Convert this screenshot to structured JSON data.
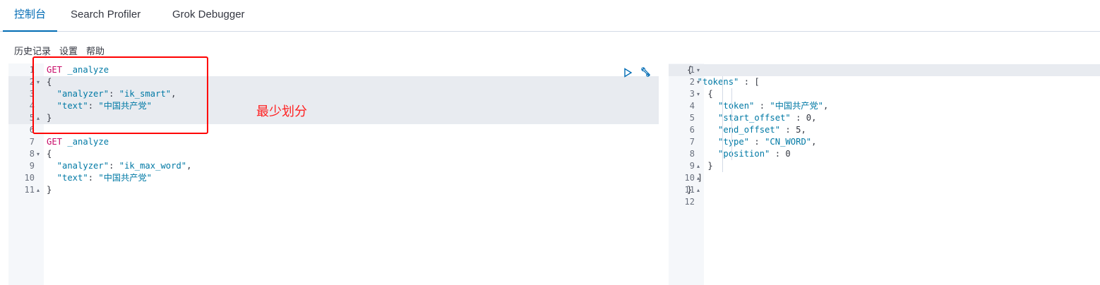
{
  "tabs": [
    {
      "label": "控制台",
      "active": true
    },
    {
      "label": "Search Profiler",
      "active": false
    },
    {
      "label": "Grok Debugger",
      "active": false
    }
  ],
  "toolbar": {
    "history": "历史记录",
    "settings": "设置",
    "help": "帮助"
  },
  "request_editor": {
    "line_numbers": [
      "1",
      "2",
      "3",
      "4",
      "5",
      "6",
      "7",
      "8",
      "9",
      "10",
      "11"
    ],
    "lines": [
      [
        {
          "t": "GET",
          "c": "kw"
        },
        {
          "t": " _analyze",
          "c": "str"
        }
      ],
      [
        {
          "t": "{",
          "c": "plain"
        }
      ],
      [
        {
          "t": "  \"analyzer\"",
          "c": "str"
        },
        {
          "t": ": ",
          "c": "plain"
        },
        {
          "t": "\"ik_smart\"",
          "c": "str"
        },
        {
          "t": ",",
          "c": "plain"
        }
      ],
      [
        {
          "t": "  \"text\"",
          "c": "str"
        },
        {
          "t": ": ",
          "c": "plain"
        },
        {
          "t": "\"中国共产党\"",
          "c": "str"
        }
      ],
      [
        {
          "t": "}",
          "c": "plain"
        }
      ],
      [],
      [
        {
          "t": "GET",
          "c": "kw"
        },
        {
          "t": " _analyze",
          "c": "str"
        }
      ],
      [
        {
          "t": "{",
          "c": "plain"
        }
      ],
      [
        {
          "t": "  \"analyzer\"",
          "c": "str"
        },
        {
          "t": ": ",
          "c": "plain"
        },
        {
          "t": "\"ik_max_word\"",
          "c": "str"
        },
        {
          "t": ",",
          "c": "plain"
        }
      ],
      [
        {
          "t": "  \"text\"",
          "c": "str"
        },
        {
          "t": ": ",
          "c": "plain"
        },
        {
          "t": "\"中国共产党\"",
          "c": "str"
        }
      ],
      [
        {
          "t": "}",
          "c": "plain"
        }
      ]
    ]
  },
  "response_editor": {
    "line_numbers": [
      "1",
      "2",
      "3",
      "4",
      "5",
      "6",
      "7",
      "8",
      "9",
      "10",
      "11",
      "12"
    ],
    "lines": [
      [
        {
          "t": "{",
          "c": "plain"
        }
      ],
      [
        {
          "t": "  \"tokens\"",
          "c": "str"
        },
        {
          "t": " : [",
          "c": "plain"
        }
      ],
      [
        {
          "t": "    {",
          "c": "plain"
        }
      ],
      [
        {
          "t": "      \"token\"",
          "c": "str"
        },
        {
          "t": " : ",
          "c": "plain"
        },
        {
          "t": "\"中国共产党\"",
          "c": "str"
        },
        {
          "t": ",",
          "c": "plain"
        }
      ],
      [
        {
          "t": "      \"start_offset\"",
          "c": "str"
        },
        {
          "t": " : ",
          "c": "plain"
        },
        {
          "t": "0",
          "c": "num"
        },
        {
          "t": ",",
          "c": "plain"
        }
      ],
      [
        {
          "t": "      \"end_offset\"",
          "c": "str"
        },
        {
          "t": " : ",
          "c": "plain"
        },
        {
          "t": "5",
          "c": "num"
        },
        {
          "t": ",",
          "c": "plain"
        }
      ],
      [
        {
          "t": "      \"type\"",
          "c": "str"
        },
        {
          "t": " : ",
          "c": "plain"
        },
        {
          "t": "\"CN_WORD\"",
          "c": "str"
        },
        {
          "t": ",",
          "c": "plain"
        }
      ],
      [
        {
          "t": "      \"position\"",
          "c": "str"
        },
        {
          "t": " : ",
          "c": "plain"
        },
        {
          "t": "0",
          "c": "num"
        }
      ],
      [
        {
          "t": "    }",
          "c": "plain"
        }
      ],
      [
        {
          "t": "  ]",
          "c": "plain"
        }
      ],
      [
        {
          "t": "}",
          "c": "plain"
        }
      ],
      []
    ]
  },
  "annotation": {
    "text": "最少划分",
    "color": "#ff0000"
  },
  "icons": {
    "run": "play-icon",
    "settings": "wrench-icon"
  },
  "colors": {
    "accent": "#006bb4",
    "keyword": "#c80a68",
    "string": "#0079a5"
  }
}
